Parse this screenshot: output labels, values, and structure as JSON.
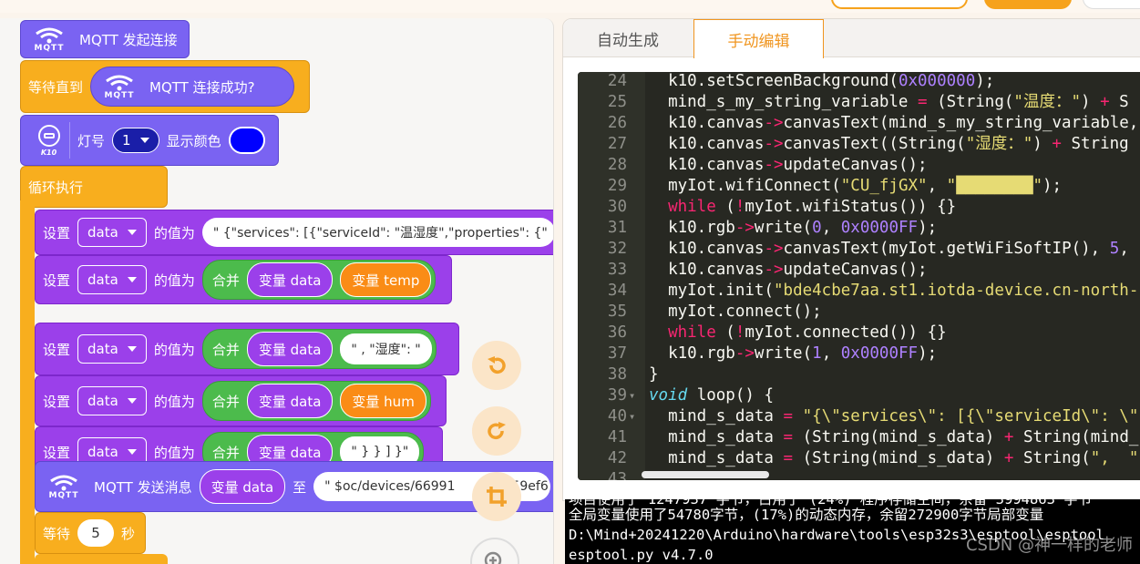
{
  "workspace": {
    "blocks": {
      "mqtt_connect": "MQTT 发起连接",
      "wait_until": "等待直到",
      "mqtt_connected": "MQTT 连接成功?",
      "led_label": "灯号",
      "led_num": "1",
      "show_color": "显示颜色",
      "k10_label": "K10",
      "loop": "循环执行",
      "set": "设置",
      "var_data": "data",
      "value_of": "的值为",
      "json_str": "\" {\"services\": [{\"serviceId\": \"温湿度\",\"properties\": {\"",
      "join": "合并",
      "var_label": "变量 data",
      "var_temp": "变量 temp",
      "str_hum_key": "\" , \"湿度\": \"",
      "var_hum": "变量 hum",
      "str_close": "\" } } ] }\"",
      "mqtt_send": "MQTT 发送消息",
      "to": "至",
      "topic": "\" $oc/devices/66991",
      "topic_tail": "59ef6",
      "wait": "等待",
      "wait_secs": "5",
      "seconds": "秒",
      "mqtt_logo": "MQTT"
    },
    "tools": [
      "undo-icon",
      "redo-icon",
      "crop-icon",
      "zoom-in-icon"
    ]
  },
  "code_panel": {
    "tabs": [
      "自动生成",
      "手动编辑"
    ],
    "active_tab": "手动编辑",
    "lines": [
      {
        "n": "24",
        "fold": "",
        "code": "  k10.setScreenBackground(0x000000);"
      },
      {
        "n": "25",
        "fold": "",
        "code": "  mind_s_my_string_variable = (String(\"温度：\") + S"
      },
      {
        "n": "26",
        "fold": "",
        "code": "  k10.canvas->canvasText(mind_s_my_string_variable,"
      },
      {
        "n": "27",
        "fold": "",
        "code": "  k10.canvas->canvasText((String(\"湿度：\") + String"
      },
      {
        "n": "28",
        "fold": "",
        "code": "  k10.canvas->updateCanvas();"
      },
      {
        "n": "29",
        "fold": "",
        "code": "  myIot.wifiConnect(\"CU_fjGX\", \"████████\");"
      },
      {
        "n": "30",
        "fold": "",
        "code": "  while (!myIot.wifiStatus()) {}"
      },
      {
        "n": "31",
        "fold": "",
        "code": "  k10.rgb->write(0, 0x0000FF);"
      },
      {
        "n": "32",
        "fold": "",
        "code": "  k10.canvas->canvasText(myIot.getWiFiSoftIP(), 5,"
      },
      {
        "n": "33",
        "fold": "",
        "code": "  k10.canvas->updateCanvas();"
      },
      {
        "n": "34",
        "fold": "",
        "code": "  myIot.init(\"bde4cbe7aa.st1.iotda-device.cn-north-"
      },
      {
        "n": "35",
        "fold": "",
        "code": "  myIot.connect();"
      },
      {
        "n": "36",
        "fold": "",
        "code": "  while (!myIot.connected()) {}"
      },
      {
        "n": "37",
        "fold": "",
        "code": "  k10.rgb->write(1, 0x0000FF);"
      },
      {
        "n": "38",
        "fold": "",
        "code": "}"
      },
      {
        "n": "39",
        "fold": "▾",
        "code": "void loop() {"
      },
      {
        "n": "40",
        "fold": "▾",
        "code": "  mind_s_data = \"{\\\"services\\\": [{\\\"serviceId\\\": \\\""
      },
      {
        "n": "41",
        "fold": "",
        "code": "  mind_s_data = (String(mind_s_data) + String(mind_"
      },
      {
        "n": "42",
        "fold": "",
        "code": "  mind_s_data = (String(mind_s_data) + String(\",  \""
      },
      {
        "n": "43",
        "fold": "",
        "code": ""
      }
    ]
  },
  "console": {
    "lines": [
      "项目使用了 1247937 字节，占用了 (24%) 程序存储空间，余留 3994863 字节",
      "全局变量使用了54780字节，(17%)的动态内存，余留272900字节局部变量",
      "D:\\Mind+20241220\\Arduino\\hardware\\tools\\esp32s3\\esptool\\esptool",
      "esptool.py v4.7.0"
    ],
    "watermark": "CSDN @神一样的老师"
  },
  "colors": {
    "accent": "#f6a21c",
    "mqtt_block": "#7a63f2",
    "set_block": "#9b40ea",
    "join_block": "#4cbb4c",
    "control_block": "#f8ae1e",
    "led_color": "#0000ff",
    "editor_bg": "#272822"
  }
}
